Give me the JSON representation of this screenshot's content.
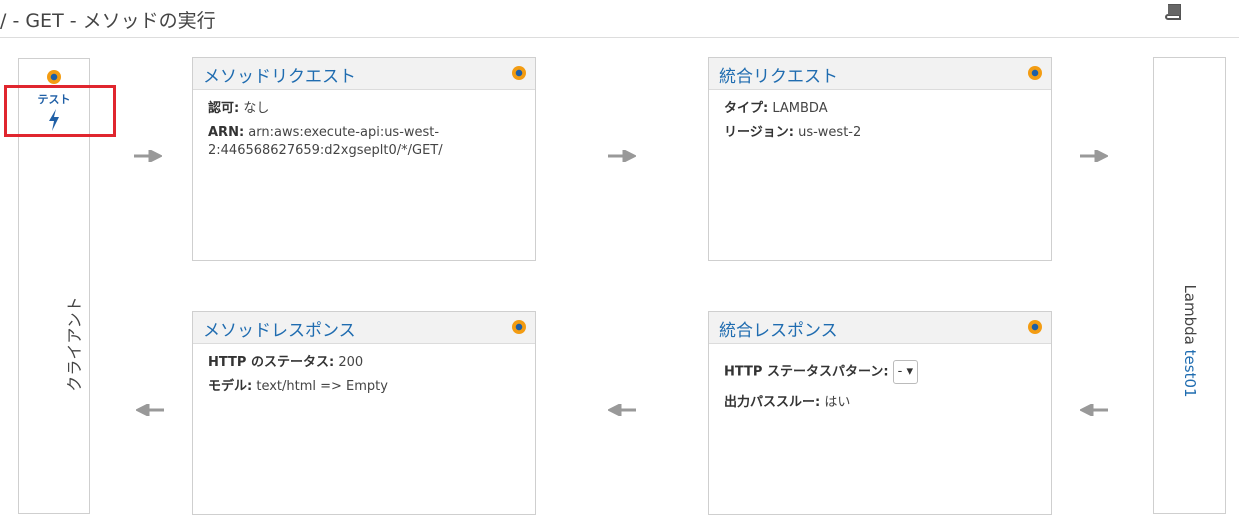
{
  "header": {
    "title": "/ - GET - メソッドの実行"
  },
  "client": {
    "test_label": "テスト",
    "label": "クライアント"
  },
  "method_request": {
    "title": "メソッドリクエスト",
    "auth_key": "認可:",
    "auth_value": "なし",
    "arn_key": "ARN:",
    "arn_value_line1": "arn:aws:execute-api:us-west-",
    "arn_value_line2": "2:446568627659:d2xgseplt0/*/GET/"
  },
  "integration_request": {
    "title": "統合リクエスト",
    "type_key": "タイプ:",
    "type_value": "LAMBDA",
    "region_key": "リージョン:",
    "region_value": "us-west-2"
  },
  "method_response": {
    "title": "メソッドレスポンス",
    "status_key": "HTTP のステータス:",
    "status_value": "200",
    "model_key": "モデル:",
    "model_value": "text/html => Empty"
  },
  "integration_response": {
    "title": "統合レスポンス",
    "pattern_key": "HTTP ステータスパターン:",
    "pattern_value": "-",
    "passthrough_key": "出力パススルー:",
    "passthrough_value": "はい"
  },
  "lambda": {
    "prefix": "Lambda",
    "function_name": "test01"
  },
  "colors": {
    "link": "#1f6cb0",
    "highlight": "#e0262e",
    "arrow": "#999999"
  }
}
